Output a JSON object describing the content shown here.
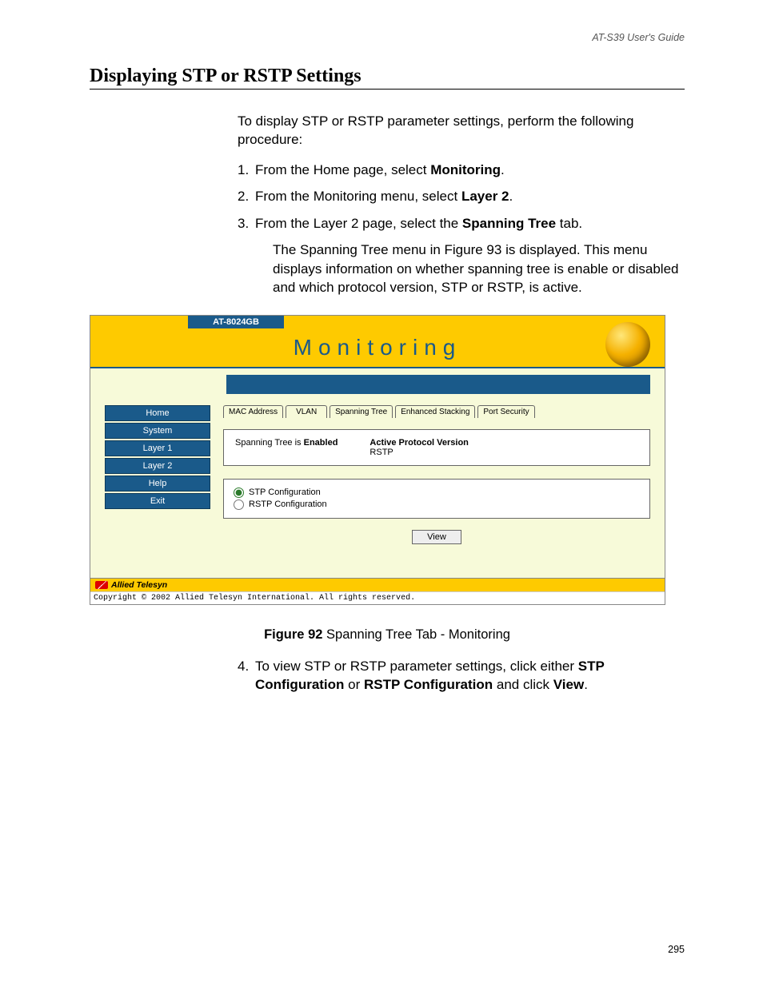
{
  "header_guide": "AT-S39 User's Guide",
  "section_title": "Displaying STP or RSTP Settings",
  "intro": "To display STP or RSTP parameter settings, perform the following procedure:",
  "steps": {
    "s1a": "From the Home page, select ",
    "s1b": "Monitoring",
    "s1c": ".",
    "s2a": "From the Monitoring menu, select ",
    "s2b": "Layer 2",
    "s2c": ".",
    "s3a": "From the Layer 2 page, select the ",
    "s3b": "Spanning Tree",
    "s3c": " tab.",
    "s3sub": "The Spanning Tree menu in Figure 93 is displayed. This menu displays information on whether spanning tree is enable or disabled and which protocol version, STP or RSTP, is active.",
    "s4a": "To view STP or RSTP parameter settings, click either ",
    "s4b": "STP Configuration",
    "s4c": " or ",
    "s4d": "RSTP Configuration",
    "s4e": " and click ",
    "s4f": "View",
    "s4g": "."
  },
  "figure": {
    "label": "Figure 92",
    "caption": "  Spanning Tree Tab - Monitoring"
  },
  "app": {
    "model": "AT-8024GB",
    "title": "Monitoring",
    "nav": [
      "Home",
      "System",
      "Layer 1",
      "Layer 2",
      "Help",
      "Exit"
    ],
    "tabs": [
      "MAC Address",
      "VLAN",
      "Spanning\nTree",
      "Enhanced\nStacking",
      "Port\nSecurity"
    ],
    "status_prefix": "Spanning Tree is ",
    "status_value": "Enabled",
    "protocol_label": "Active Protocol Version",
    "protocol_value": "RSTP",
    "radios": [
      "STP Configuration",
      "RSTP Configuration"
    ],
    "view_btn": "View",
    "brand": "Allied Telesyn",
    "copyright": "Copyright © 2002 Allied Telesyn International. All rights reserved."
  },
  "page_number": "295"
}
